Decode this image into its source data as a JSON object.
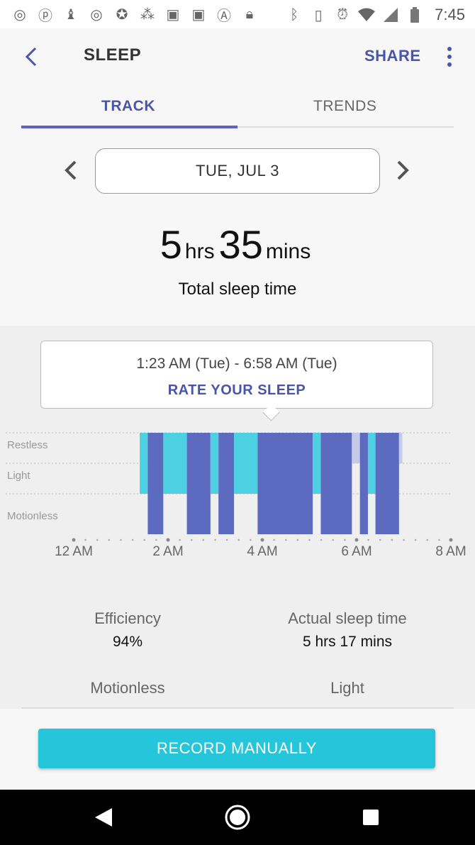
{
  "status_bar": {
    "left_icons": [
      "chrome-icon",
      "pinterest-icon",
      "hangouts-icon",
      "chrome-icon",
      "ninja-icon",
      "dots-icon",
      "flipboard-icon",
      "flipboard-icon",
      "a-icon",
      "lock-icon"
    ],
    "right_icons": [
      "bluetooth-icon",
      "vibrate-icon",
      "alarm-icon",
      "wifi-icon",
      "signal-icon",
      "battery-icon"
    ],
    "time": "7:45"
  },
  "header": {
    "title": "SLEEP",
    "share_label": "SHARE"
  },
  "tabs": [
    {
      "label": "TRACK",
      "active": true
    },
    {
      "label": "TRENDS",
      "active": false
    }
  ],
  "date": {
    "label": "TUE, JUL 3"
  },
  "summary": {
    "hours": "5",
    "hours_unit": "hrs",
    "minutes": "35",
    "minutes_unit": "mins",
    "label": "Total sleep time"
  },
  "tooltip": {
    "range": "1:23 AM (Tue) - 6:58 AM (Tue)",
    "action": "RATE YOUR SLEEP"
  },
  "chart_data": {
    "type": "area",
    "y_levels": [
      "Restless",
      "Light",
      "Motionless"
    ],
    "x_ticks": [
      "12 AM",
      "2 AM",
      "4 AM",
      "6 AM",
      "8 AM"
    ],
    "x_range_hours": [
      0,
      8
    ],
    "colors": {
      "light": "#4dd0e1",
      "motionless": "#5c6bc0",
      "restless": "#c5cae9"
    },
    "segments": [
      {
        "start": 1.4,
        "end": 1.57,
        "level": "Light"
      },
      {
        "start": 1.57,
        "end": 1.9,
        "level": "Motionless"
      },
      {
        "start": 1.9,
        "end": 2.4,
        "level": "Light"
      },
      {
        "start": 2.4,
        "end": 2.9,
        "level": "Motionless"
      },
      {
        "start": 2.9,
        "end": 3.07,
        "level": "Light"
      },
      {
        "start": 3.07,
        "end": 3.4,
        "level": "Motionless"
      },
      {
        "start": 3.4,
        "end": 3.9,
        "level": "Light"
      },
      {
        "start": 3.9,
        "end": 5.07,
        "level": "Motionless"
      },
      {
        "start": 5.07,
        "end": 5.24,
        "level": "Light"
      },
      {
        "start": 5.24,
        "end": 5.9,
        "level": "Motionless"
      },
      {
        "start": 5.9,
        "end": 6.07,
        "level": "Restless"
      },
      {
        "start": 6.07,
        "end": 6.24,
        "level": "Motionless"
      },
      {
        "start": 6.24,
        "end": 6.4,
        "level": "Light"
      },
      {
        "start": 6.4,
        "end": 6.9,
        "level": "Motionless"
      },
      {
        "start": 6.9,
        "end": 6.97,
        "level": "Restless"
      }
    ]
  },
  "stats": [
    {
      "label": "Efficiency",
      "value": "94%"
    },
    {
      "label": "Actual sleep time",
      "value": "5 hrs 17 mins"
    },
    {
      "label": "Motionless",
      "value": ""
    },
    {
      "label": "Light",
      "value": ""
    }
  ],
  "record_button": {
    "label": "RECORD MANUALLY"
  }
}
